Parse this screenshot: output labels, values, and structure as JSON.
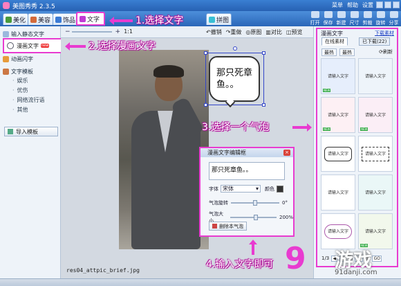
{
  "window": {
    "title": "美图秀秀 2.3.5",
    "menu": [
      "菜单",
      "帮助",
      "设置"
    ]
  },
  "tabs": [
    {
      "label": "美化",
      "color": "#4a9a3a"
    },
    {
      "label": "美容",
      "color": "#d46a3a"
    },
    {
      "label": "饰品",
      "color": "#3a7ad4"
    },
    {
      "label": "文字",
      "color": "#c03ad4",
      "active": true
    },
    {
      "label": "拼图",
      "color": "#3ac0d4"
    }
  ],
  "toolbar": [
    "打开",
    "保存",
    "新建",
    "尺寸",
    "剪裁",
    "旋转",
    "分享"
  ],
  "subbar": {
    "zoom_ratio": "1:1",
    "actions": [
      "撤销",
      "重做",
      "原图",
      "对比",
      "预览"
    ]
  },
  "left_panel": {
    "top_item": "输入静态文字",
    "manga": "漫画文字",
    "manga_badge": "new",
    "dynamic": "动画闪字",
    "template_header": "文字模板",
    "templates": [
      "娱乐",
      "优伤",
      "网络流行语",
      "其他"
    ],
    "import": "导入模板"
  },
  "canvas": {
    "filename": "res04_attpic_brief.jpg"
  },
  "bubble": {
    "text": "那只死章鱼。。"
  },
  "dialog": {
    "title": "漫画文字编辑框",
    "close": "×",
    "text": "那只死章鱼。。",
    "font_label": "字体",
    "font_value": "宋体",
    "color_label": "颜色",
    "text_color": "#333333",
    "rotation_label": "气泡旋转",
    "rotation_value": "0°",
    "size_label": "气泡大小",
    "size_value": "200%",
    "delete_label": "删除本气泡"
  },
  "right_panel": {
    "header": "漫画文字",
    "download_link": "下载素材",
    "tab_online": "在线素材",
    "tab_downloaded": "已下载(22)",
    "chip_hot": "最热",
    "chip_new": "最热",
    "refresh": "刷新",
    "bubbles": [
      "请输入文字",
      "请输入文字",
      "请输入文字",
      "请输入文字",
      "请输入文字",
      "请输入文字",
      "请输入文字",
      "请输入文字",
      "请输入文字",
      "请输入文字"
    ],
    "new_tag": "NEW",
    "pager": {
      "current": "1/3",
      "jump_prefix": "到",
      "jump_suffix": "页",
      "go": "GO"
    }
  },
  "annotations": {
    "step1": "1.选择文字",
    "step2": "2.选择漫画文字",
    "step3": "3.选择一个气泡",
    "step4": "4.输入文字即可"
  },
  "watermark": {
    "nine": "9",
    "game": "游戏",
    "domain": "91danji.com"
  }
}
